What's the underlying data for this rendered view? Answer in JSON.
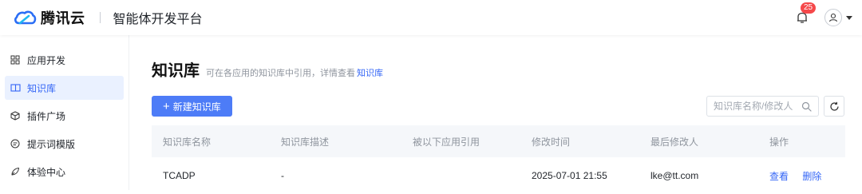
{
  "header": {
    "brand": "腾讯云",
    "platform": "智能体开发平台",
    "notification_count": "25",
    "accent": "#3466f6",
    "badge_color": "#f5484a"
  },
  "sidebar": {
    "items": [
      {
        "label": "应用开发",
        "icon": "grid-icon",
        "active": false
      },
      {
        "label": "知识库",
        "icon": "book-icon",
        "active": true
      },
      {
        "label": "插件广场",
        "icon": "cube-icon",
        "active": false
      },
      {
        "label": "提示词模版",
        "icon": "prompt-icon",
        "active": false
      },
      {
        "label": "体验中心",
        "icon": "rocket-icon",
        "active": false
      }
    ]
  },
  "main": {
    "title": "知识库",
    "description": "可在各应用的知识库中引用，详情查看",
    "description_link": "知识库",
    "new_button": "新建知识库",
    "search_placeholder": "知识库名称/修改人",
    "table": {
      "columns": [
        "知识库名称",
        "知识库描述",
        "被以下应用引用",
        "修改时间",
        "最后修改人",
        "操作"
      ],
      "rows": [
        {
          "name": "TCADP",
          "description": "-",
          "referenced_by": "",
          "modified_time": "2025-07-01 21:55",
          "modified_by": "lke@tt.com",
          "actions": [
            "查看",
            "删除"
          ]
        }
      ]
    }
  }
}
